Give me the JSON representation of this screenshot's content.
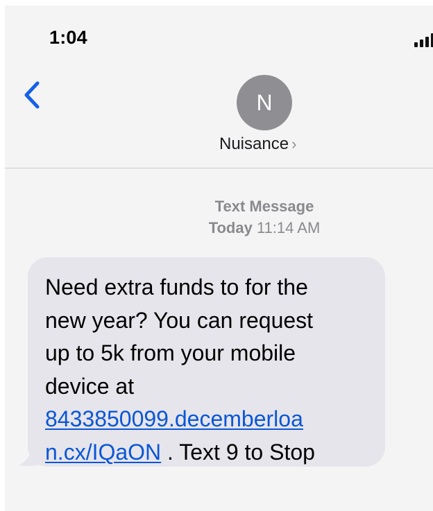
{
  "status_bar": {
    "time": "1:04",
    "signal_icon": "cellular-signal-icon"
  },
  "nav": {
    "back_icon": "chevron-left-icon",
    "avatar_initial": "N",
    "contact_name": "Nuisance",
    "contact_chevron": "›"
  },
  "thread": {
    "service_label": "Text Message",
    "date_label": "Today",
    "time_label": "11:14 AM"
  },
  "message": {
    "line1": "Need extra funds to for the",
    "line2": "new year? You can request",
    "line3": "up to 5k from your mobile",
    "line4": "device at",
    "link_part1": "8433850099.decemberloa",
    "link_part2": "n.cx/IQaON",
    "suffix": " . Text 9 to Stop"
  },
  "colors": {
    "accent_blue": "#0a56d6",
    "bubble_gray": "#e6e5eb",
    "avatar_gray": "#8e8e93",
    "background": "#f4f4f5"
  }
}
